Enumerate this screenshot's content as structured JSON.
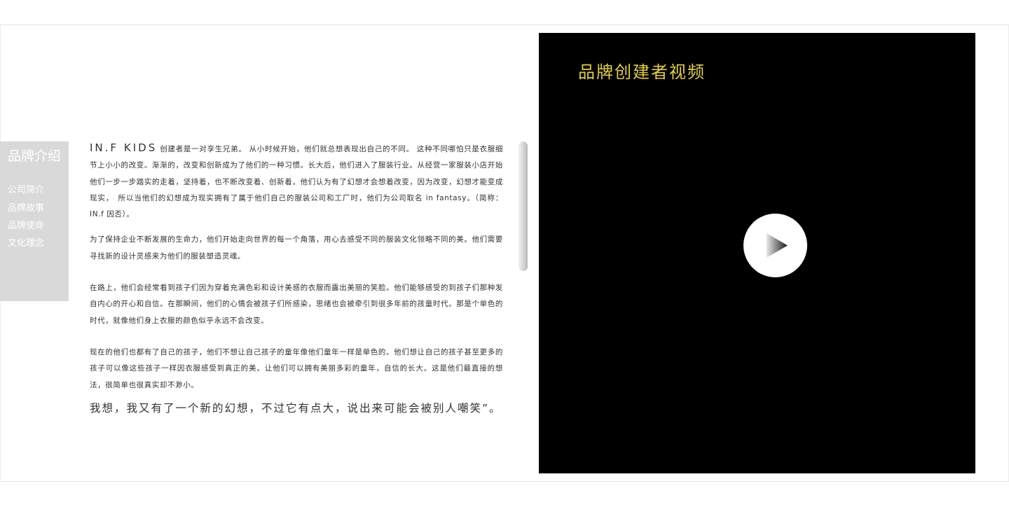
{
  "sidebar": {
    "title": "品牌介绍",
    "items": [
      {
        "label": "公司简介"
      },
      {
        "label": "品牌故事"
      },
      {
        "label": "品牌使命"
      },
      {
        "label": "文化理念"
      }
    ]
  },
  "article": {
    "brand": "IN.F KIDS",
    "p1": " 创建者是一对孪生兄弟。 从小时候开始，他们就总想表现出自己的不同。 这种不同哪怕只是衣服细节上小小的改变。渐渐的，改变和创新成为了他们的一种习惯。长大后，他们进入了服装行业。从经营一家服装小店开始他们一步一步踏实的走着，坚持着，也不断改变着、创新着。他们认为有了幻想才会想着改变，因为改变，幻想才能变成现实，　所以当他们的幻想成为现实拥有了属于他们自己的服装公司和工厂时，他们为公司取名 in fantasy。（简称：IN.f 因否）。",
    "p2": "为了保持企业不断发展的生命力，他们开始走向世界的每一个角落，用心去感受不同的服装文化领略不同的美。他们需要寻找新的设计灵感来为他们的服装塑造灵魂。",
    "p3": "在路上，他们会经常看到孩子们因为穿着充满色彩和设计美感的衣服而露出美丽的笑脸。他们能够感受的到孩子们那种发自内心的开心和自信。在那瞬间，他们的心情会被孩子们所感染，思绪也会被牵引到很多年前的孩童时代。那是个单色的时代，就像他们身上衣服的颜色似乎永远不会改变。",
    "p4": "现在的他们也都有了自己的孩子，他们不想让自己孩子的童年像他们童年一样是单色的。他们想让自己的孩子甚至更多的孩子可以像这些孩子一样因衣服感受到真正的美。让他们可以拥有美丽多彩的童年，自信的长大。这是他们最直接的想法，很简单也很真实却不渺小。",
    "quote": "我想，我又有了一个新的幻想，不过它有点大，说出来可能会被别人嘲笑”。"
  },
  "video": {
    "title": "品牌创建者视频",
    "play_icon": "play-icon",
    "title_color": "#e2cf3a",
    "background": "#000000"
  }
}
